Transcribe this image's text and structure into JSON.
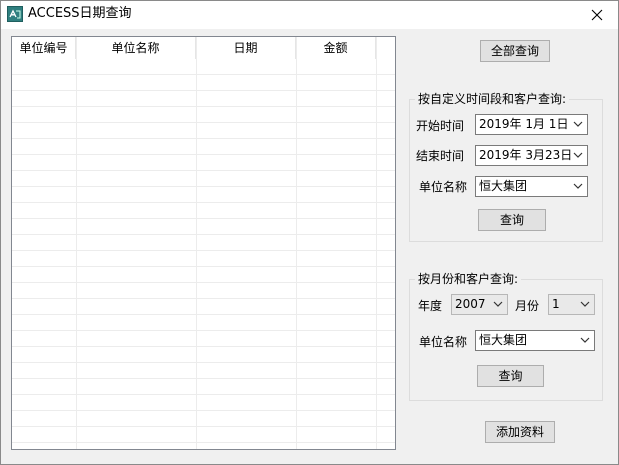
{
  "window": {
    "title": "ACCESS日期查询",
    "close_icon": "close-icon",
    "app_icon": "access-app-icon"
  },
  "grid": {
    "columns": [
      "单位编号",
      "单位名称",
      "日期",
      "金额"
    ],
    "rows": []
  },
  "buttons": {
    "query_all": "全部查询",
    "query_range": "查询",
    "query_month": "查询",
    "add_data": "添加资料"
  },
  "range_group": {
    "title": "按自定义时间段和客户查询:",
    "start_label": "开始时间",
    "start_value": "2019年  1月  1日",
    "end_label": "结束时间",
    "end_value": "2019年  3月23日",
    "unit_label": "单位名称",
    "unit_value": "恒大集团"
  },
  "month_group": {
    "title": "按月份和客户查询:",
    "year_label": "年度",
    "year_value": "2007",
    "month_label": "月份",
    "month_value": "1",
    "unit_label": "单位名称",
    "unit_value": "恒大集团"
  }
}
